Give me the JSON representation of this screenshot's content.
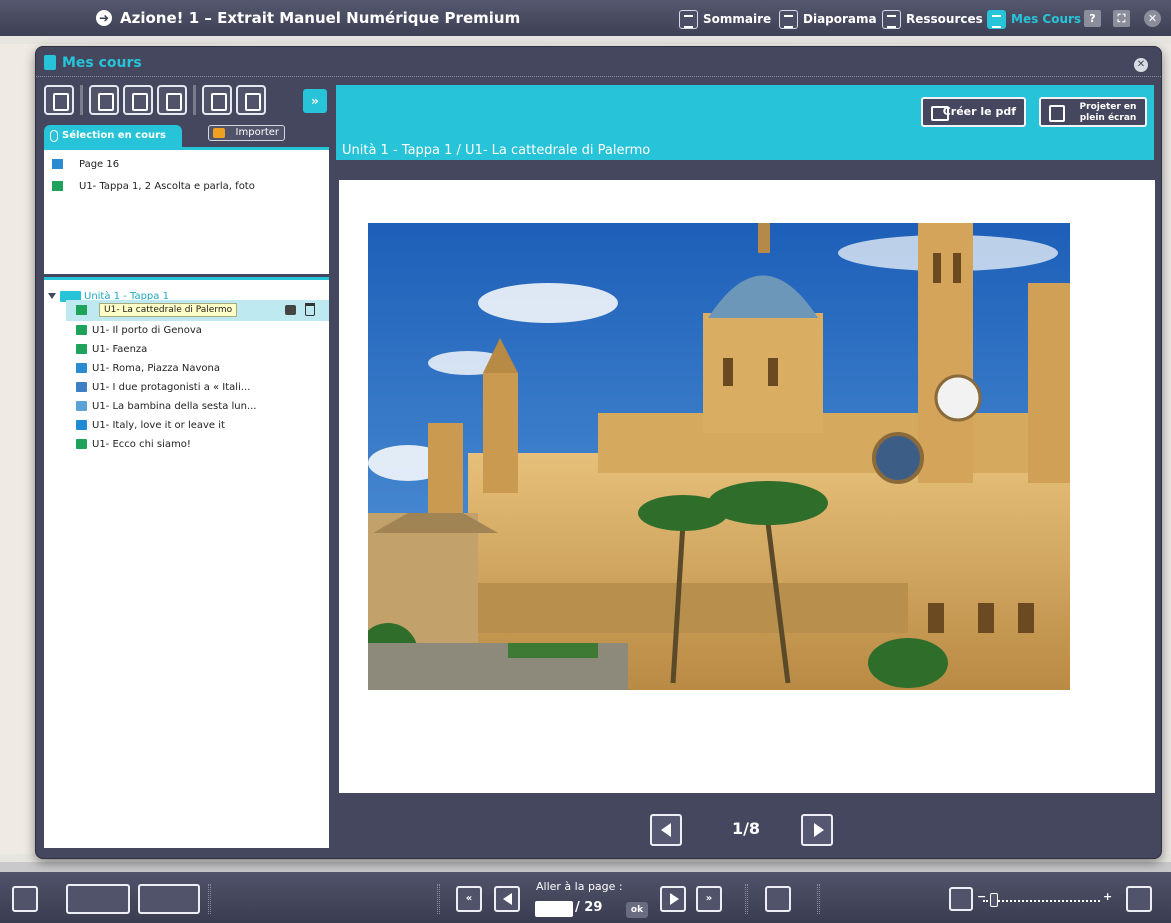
{
  "app": {
    "title": "Azione! 1 – Extrait Manuel Numérique Premium"
  },
  "topnav": {
    "sommaire": "Sommaire",
    "diaporama": "Diaporama",
    "ressources": "Ressources",
    "mes_cours": "Mes Cours",
    "help": "?",
    "close": "✕"
  },
  "modal": {
    "title": "Mes cours",
    "close": "✕",
    "expand": "»",
    "selection_tab": "Sélection en cours",
    "import_button": "Importer",
    "selection_items": [
      {
        "label": "Page 16",
        "icon": "page-icon"
      },
      {
        "label": "U1- Tappa 1, 2 Ascolta e parla, foto",
        "icon": "image-icon"
      }
    ],
    "tree": {
      "root_label": "Unità 1 - Tappa 1",
      "selected_tooltip": "U1- La cattedrale di Palermo",
      "items": [
        {
          "label": "U1- Il porto di Genova",
          "icon": "image-icon"
        },
        {
          "label": "U1- Faenza",
          "icon": "image-icon"
        },
        {
          "label": "U1- Roma, Piazza Navona",
          "icon": "image-icon"
        },
        {
          "label": "U1- I due protagonisti a « Itali...",
          "icon": "audio-icon"
        },
        {
          "label": "U1- La bambina della sesta lun...",
          "icon": "image-icon"
        },
        {
          "label": "U1- Italy, love it or leave it",
          "icon": "video-icon"
        },
        {
          "label": "U1- Ecco chi siamo!",
          "icon": "image-icon"
        }
      ]
    },
    "breadcrumb": "Unità 1 - Tappa 1 / U1- La cattedrale di Palermo",
    "pdf_button": "Créer le pdf",
    "project_button_line1": "Projeter en",
    "project_button_line2": "plein écran",
    "pager": "1/8"
  },
  "bottombar": {
    "goto_label": "Aller à la page :",
    "goto_total": "/ 29",
    "goto_ok": "ok",
    "first": "«",
    "last": "»"
  },
  "colors": {
    "accent": "#27c3d9",
    "frame": "#44475d",
    "bar": "#3d4055"
  }
}
